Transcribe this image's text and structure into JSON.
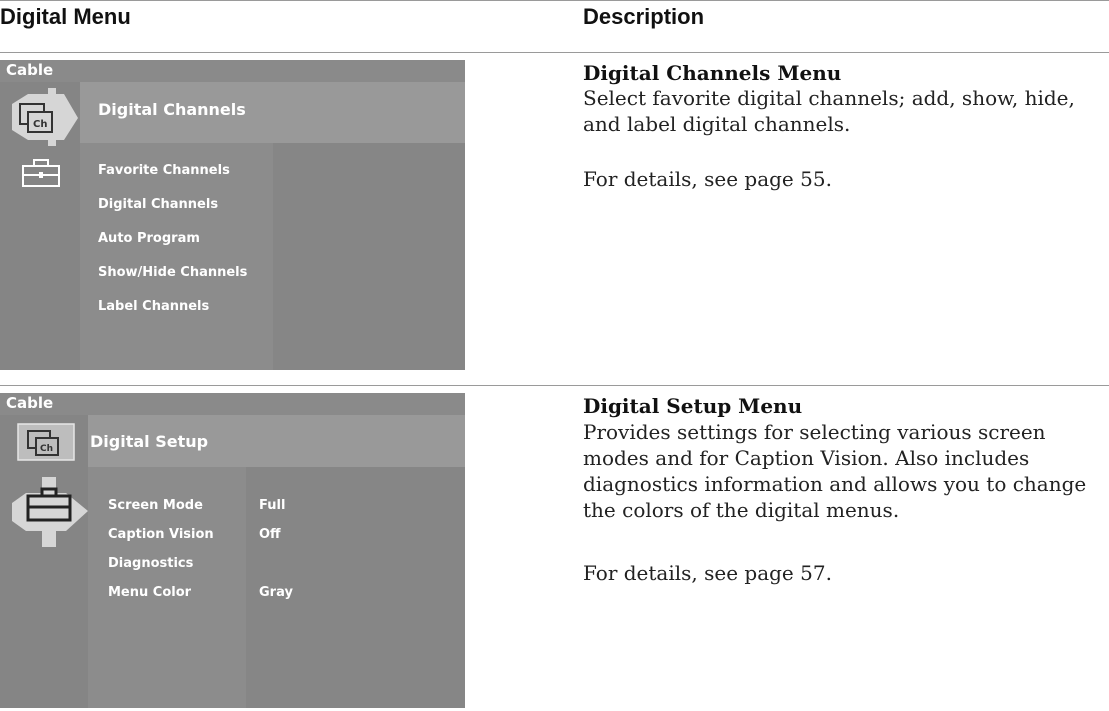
{
  "headers": {
    "left": "Digital Menu",
    "right": "Description"
  },
  "menus": [
    {
      "source": "Cable",
      "title": "Digital Channels",
      "items": [
        {
          "label": "Favorite Channels",
          "value": ""
        },
        {
          "label": "Digital Channels",
          "value": ""
        },
        {
          "label": "Auto Program",
          "value": ""
        },
        {
          "label": "Show/Hide Channels",
          "value": ""
        },
        {
          "label": "Label Channels",
          "value": ""
        }
      ],
      "selected_icon": "channel-icon"
    },
    {
      "source": "Cable",
      "title": "Digital Setup",
      "items": [
        {
          "label": "Screen Mode",
          "value": "Full"
        },
        {
          "label": "Caption Vision",
          "value": "Off"
        },
        {
          "label": "Diagnostics",
          "value": ""
        },
        {
          "label": "Menu Color",
          "value": "Gray"
        }
      ],
      "selected_icon": "toolbox-icon"
    }
  ],
  "descriptions": [
    {
      "title": "Digital Channels Menu",
      "body": "Select favorite digital channels; add, show, hide, and label digital channels.",
      "ref": "For details, see page 55."
    },
    {
      "title": "Digital Setup Menu",
      "body": "Provides settings for selecting various screen modes and for Caption Vision. Also includes diagnostics information and allows you to change the colors of the digital menus.",
      "ref": "For details, see page 57."
    }
  ],
  "colors": {
    "panel": "#8f8f8f",
    "text": "#ffffff",
    "rule": "#9a9a9a"
  }
}
